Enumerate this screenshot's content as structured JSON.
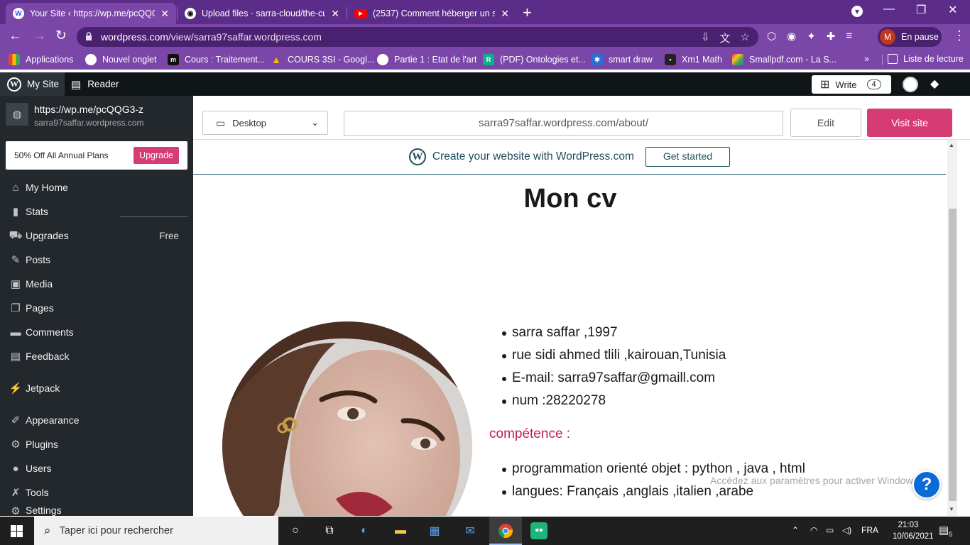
{
  "browser": {
    "tabs": [
      {
        "title": "Your Site ‹ https://wp.me/pcQQG",
        "favicon": "wordpress-icon"
      },
      {
        "title": "Upload files · sarra-cloud/the-cur",
        "favicon": "github-icon"
      },
      {
        "title": "(2537) Comment héberger un site",
        "favicon": "youtube-icon"
      }
    ],
    "url_domain": "wordpress.com",
    "url_path": "/view/sarra97saffar.wordpress.com",
    "profile_initial": "M",
    "profile_status": "En pause",
    "bookmarks": [
      "Applications",
      "Nouvel onglet",
      "Cours : Traitement...",
      "COURS 3SI - Googl...",
      "Partie 1 : Etat de l'art",
      "(PDF) Ontologies et...",
      "smart draw",
      "Xm1 Math",
      "Smallpdf.com - La S..."
    ],
    "reading_list": "Liste de lecture",
    "overflow": "»"
  },
  "masterbar": {
    "my_site": "My Site",
    "reader": "Reader",
    "write": "Write",
    "write_count": "4"
  },
  "sidebar": {
    "site_title": "https://wp.me/pcQQG3-z",
    "site_url": "sarra97saffar.wordpress.com",
    "promo_text": "50% Off All Annual Plans",
    "promo_button": "Upgrade",
    "items": [
      {
        "label": "My Home",
        "icon": "home-icon"
      },
      {
        "label": "Stats",
        "icon": "stats-icon"
      },
      {
        "label": "Upgrades",
        "icon": "cart-icon",
        "badge": "Free"
      },
      {
        "label": "Posts",
        "icon": "pin-icon"
      },
      {
        "label": "Media",
        "icon": "media-icon"
      },
      {
        "label": "Pages",
        "icon": "pages-icon"
      },
      {
        "label": "Comments",
        "icon": "comments-icon"
      },
      {
        "label": "Feedback",
        "icon": "feedback-icon"
      },
      {
        "label": "Jetpack",
        "icon": "jetpack-icon"
      },
      {
        "label": "Appearance",
        "icon": "brush-icon"
      },
      {
        "label": "Plugins",
        "icon": "plug-icon"
      },
      {
        "label": "Users",
        "icon": "user-icon"
      },
      {
        "label": "Tools",
        "icon": "wrench-icon"
      },
      {
        "label": "Settings",
        "icon": "settings-icon"
      }
    ]
  },
  "preview_bar": {
    "device": "Desktop",
    "url": "sarra97saffar.wordpress.com/about/",
    "edit": "Edit",
    "visit": "Visit site"
  },
  "preview": {
    "banner_text": "Create your website with WordPress.com",
    "banner_button": "Get started",
    "page_title": "Mon cv",
    "info": [
      "sarra saffar ,1997",
      "rue sidi ahmed tlili ,kairouan,Tunisia",
      "E-mail: sarra97saffar@gmaill.com",
      "num :28220278"
    ],
    "competence_heading": "compétence :",
    "skills": [
      "programmation orienté objet : python , java , html",
      "langues: Français ,anglais ,italien ,arabe"
    ],
    "watermark": "Accédez aux paramètres pour activer Windows."
  },
  "taskbar": {
    "search_placeholder": "Taper ici pour rechercher",
    "language": "FRA",
    "time": "21:03",
    "date": "10/06/2021",
    "notifications": "5"
  },
  "colors": {
    "chrome_frame": "#5b2d88",
    "wp_sidebar": "#23282d",
    "accent_pink": "#d63b73",
    "competence_red": "#bf1e4b"
  }
}
